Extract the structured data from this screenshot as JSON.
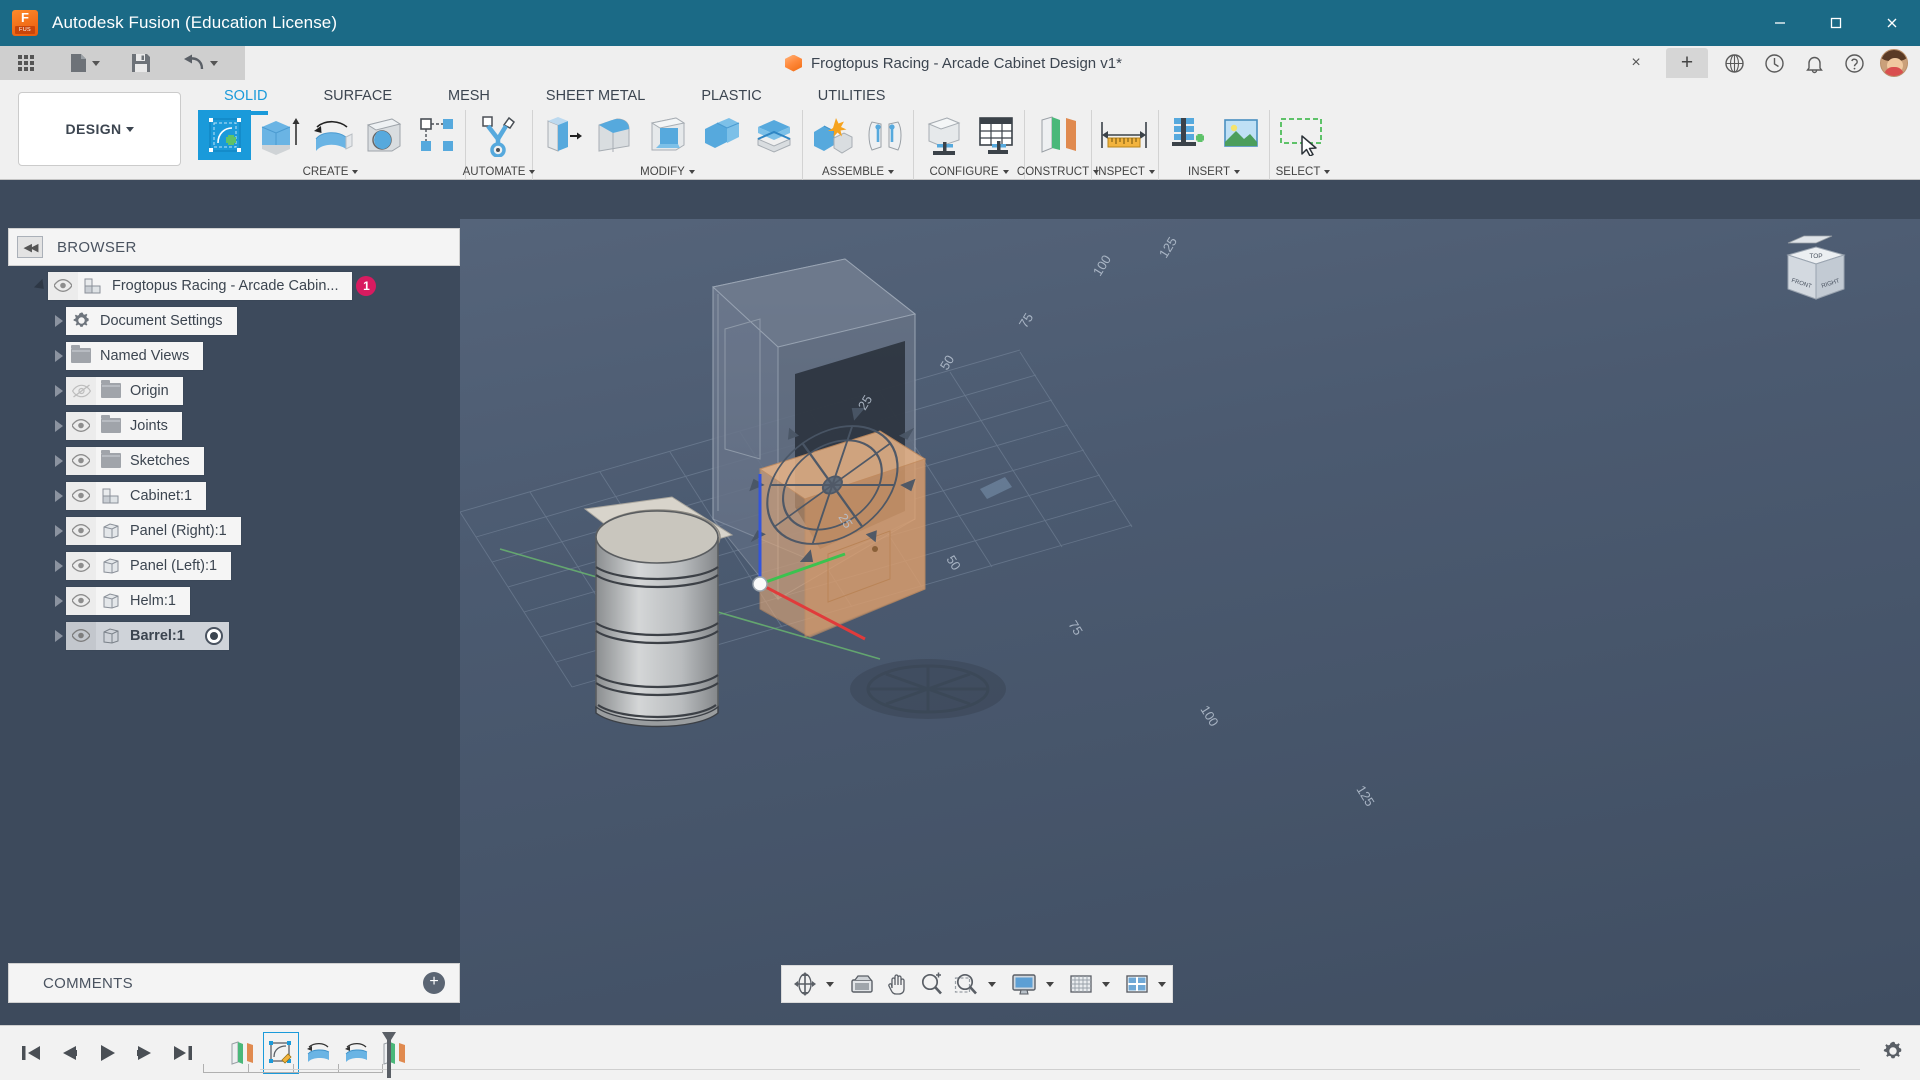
{
  "app": {
    "title": "Autodesk Fusion (Education License)",
    "logo_icon": "fusion-logo",
    "window_controls": [
      "minimize",
      "maximize",
      "close"
    ]
  },
  "quick_access": {
    "items": [
      {
        "name": "app-grid",
        "icon": "grid-icon",
        "has_caret": false
      },
      {
        "name": "new-file",
        "icon": "file-icon",
        "has_caret": true
      },
      {
        "name": "save",
        "icon": "save-icon",
        "has_caret": false
      },
      {
        "name": "undo",
        "icon": "undo-icon",
        "has_caret": true
      },
      {
        "name": "redo",
        "icon": "redo-icon",
        "has_caret": true
      }
    ]
  },
  "document_tab": {
    "title": "Frogtopus Racing - Arcade Cabinet Design v1*",
    "icon": "orange-cube-icon",
    "close_label": "×",
    "new_tab_label": "+"
  },
  "title_icons": [
    {
      "name": "extensions-icon"
    },
    {
      "name": "recent-icon"
    },
    {
      "name": "notifications-icon"
    },
    {
      "name": "help-icon"
    }
  ],
  "workspace": {
    "label": "DESIGN",
    "caret": true
  },
  "ribbon": {
    "tabs": [
      {
        "label": "SOLID",
        "active": true
      },
      {
        "label": "SURFACE",
        "active": false
      },
      {
        "label": "MESH",
        "active": false
      },
      {
        "label": "SHEET METAL",
        "active": false
      },
      {
        "label": "PLASTIC",
        "active": false
      },
      {
        "label": "UTILITIES",
        "active": false
      }
    ],
    "panels": [
      {
        "label": "CREATE",
        "has_caret": true,
        "commands": [
          {
            "name": "create-sketch",
            "icon": "sketch-plus-icon",
            "selected": true
          },
          {
            "name": "extrude",
            "icon": "extrude-icon",
            "selected": false
          },
          {
            "name": "revolve",
            "icon": "revolve-icon",
            "selected": false
          },
          {
            "name": "hole",
            "icon": "hole-icon",
            "selected": false
          },
          {
            "name": "pattern",
            "icon": "pattern-icon",
            "selected": false
          }
        ]
      },
      {
        "label": "AUTOMATE",
        "has_caret": true,
        "commands": [
          {
            "name": "automated-modeling",
            "icon": "automate-icon",
            "selected": false
          }
        ]
      },
      {
        "label": "MODIFY",
        "has_caret": true,
        "commands": [
          {
            "name": "press-pull",
            "icon": "press-pull-icon",
            "selected": false
          },
          {
            "name": "fillet",
            "icon": "fillet-icon",
            "selected": false
          },
          {
            "name": "shell",
            "icon": "shell-icon",
            "selected": false
          },
          {
            "name": "combine",
            "icon": "combine-icon",
            "selected": false
          },
          {
            "name": "offset-face",
            "icon": "offset-face-icon",
            "selected": false
          }
        ]
      },
      {
        "label": "ASSEMBLE",
        "has_caret": true,
        "commands": [
          {
            "name": "new-component",
            "icon": "new-component-icon",
            "selected": false
          },
          {
            "name": "joint",
            "icon": "joint-icon",
            "selected": false
          }
        ]
      },
      {
        "label": "CONFIGURE",
        "has_caret": true,
        "commands": [
          {
            "name": "configuration",
            "icon": "configuration-icon",
            "selected": false
          },
          {
            "name": "configuration-table",
            "icon": "config-table-icon",
            "selected": false
          }
        ]
      },
      {
        "label": "CONSTRUCT",
        "has_caret": true,
        "commands": [
          {
            "name": "offset-plane",
            "icon": "offset-plane-icon",
            "selected": false
          }
        ]
      },
      {
        "label": "INSPECT",
        "has_caret": true,
        "commands": [
          {
            "name": "measure",
            "icon": "measure-icon",
            "selected": false
          }
        ]
      },
      {
        "label": "INSERT",
        "has_caret": true,
        "commands": [
          {
            "name": "insert-derive",
            "icon": "insert-derive-icon",
            "selected": false
          },
          {
            "name": "canvas",
            "icon": "insert-canvas-icon",
            "selected": false
          }
        ]
      },
      {
        "label": "SELECT",
        "has_caret": true,
        "commands": [
          {
            "name": "select-window",
            "icon": "select-window-icon",
            "selected": false
          }
        ]
      }
    ]
  },
  "browser": {
    "header": "BROWSER",
    "collapse_icon": "collapse-left-icon",
    "items": [
      {
        "label": "Frogtopus Racing - Arcade Cabin...",
        "icon": "component-icon",
        "eye": "visible",
        "indent": 0,
        "twisty": "open",
        "badge": "1",
        "selected": false
      },
      {
        "label": "Document Settings",
        "icon": "gear-icon",
        "eye": "none",
        "indent": 1,
        "twisty": "closed",
        "selected": false
      },
      {
        "label": "Named Views",
        "icon": "folder-icon",
        "eye": "none",
        "indent": 1,
        "twisty": "closed",
        "selected": false
      },
      {
        "label": "Origin",
        "icon": "folder-icon",
        "eye": "hidden",
        "indent": 1,
        "twisty": "closed",
        "selected": false
      },
      {
        "label": "Joints",
        "icon": "folder-icon",
        "eye": "visible",
        "indent": 1,
        "twisty": "closed",
        "selected": false
      },
      {
        "label": "Sketches",
        "icon": "folder-icon",
        "eye": "visible",
        "indent": 1,
        "twisty": "closed",
        "selected": false
      },
      {
        "label": "Cabinet:1",
        "icon": "component-icon",
        "eye": "visible",
        "indent": 1,
        "twisty": "closed",
        "selected": false
      },
      {
        "label": "Panel (Right):1",
        "icon": "body-icon",
        "eye": "visible",
        "indent": 1,
        "twisty": "closed",
        "selected": false
      },
      {
        "label": "Panel (Left):1",
        "icon": "body-icon",
        "eye": "visible",
        "indent": 1,
        "twisty": "closed",
        "selected": false
      },
      {
        "label": "Helm:1",
        "icon": "body-icon",
        "eye": "visible",
        "indent": 1,
        "twisty": "closed",
        "selected": false
      },
      {
        "label": "Barrel:1",
        "icon": "body-icon",
        "eye": "visible",
        "indent": 1,
        "twisty": "closed",
        "selected": true,
        "radio": true
      }
    ]
  },
  "comments": {
    "label": "COMMENTS",
    "add_label": "+"
  },
  "navbar": {
    "items": [
      {
        "name": "orbit",
        "icon": "orbit-icon",
        "has_caret": true
      },
      {
        "name": "look-at",
        "icon": "look-at-icon",
        "has_caret": false
      },
      {
        "name": "pan",
        "icon": "pan-hand-icon",
        "has_caret": false
      },
      {
        "name": "zoom",
        "icon": "zoom-plus-icon",
        "has_caret": false
      },
      {
        "name": "zoom-window",
        "icon": "zoom-window-icon",
        "has_caret": true
      },
      {
        "name": "display-settings",
        "icon": "monitor-icon",
        "has_caret": true
      },
      {
        "name": "grid-snaps",
        "icon": "grid-icon",
        "has_caret": true
      },
      {
        "name": "viewports",
        "icon": "viewports-icon",
        "has_caret": true
      }
    ]
  },
  "timeline": {
    "playback": [
      {
        "name": "go-to-beginning",
        "icon": "skip-start-icon"
      },
      {
        "name": "step-back",
        "icon": "step-back-icon"
      },
      {
        "name": "play",
        "icon": "play-icon"
      },
      {
        "name": "step-forward",
        "icon": "step-forward-icon"
      },
      {
        "name": "go-to-end",
        "icon": "skip-end-icon"
      }
    ],
    "features": [
      {
        "name": "feature-component",
        "icon": "component-feature-icon",
        "selected": false
      },
      {
        "name": "feature-sketch",
        "icon": "sketch-feature-icon",
        "selected": true
      },
      {
        "name": "feature-revolve-1",
        "icon": "revolve-feature-icon",
        "selected": false
      },
      {
        "name": "feature-revolve-2",
        "icon": "revolve-feature-icon",
        "selected": false
      },
      {
        "name": "feature-component-2",
        "icon": "component-feature-icon",
        "selected": false
      }
    ],
    "settings_icon": "gear-icon"
  },
  "canvas": {
    "view_cube": {
      "top": "TOP",
      "front": "FRONT",
      "right": "RIGHT"
    },
    "grid_dimension_labels": [
      "125",
      "100",
      "75",
      "50",
      "25",
      "25",
      "25",
      "50",
      "75",
      "100",
      "125"
    ],
    "origin_axes": [
      "x-axis-red",
      "y-axis-green",
      "z-axis-blue"
    ],
    "model_parts": [
      "cabinet-shell",
      "helm-wheel",
      "barrel",
      "panel-right",
      "panel-left"
    ]
  },
  "colors": {
    "title_bar": "#1b6a86",
    "accent_blue": "#1a9ada",
    "canvas_bg": "#4b5a70",
    "badge": "#d81b60",
    "brand_orange": "#f06a10"
  }
}
